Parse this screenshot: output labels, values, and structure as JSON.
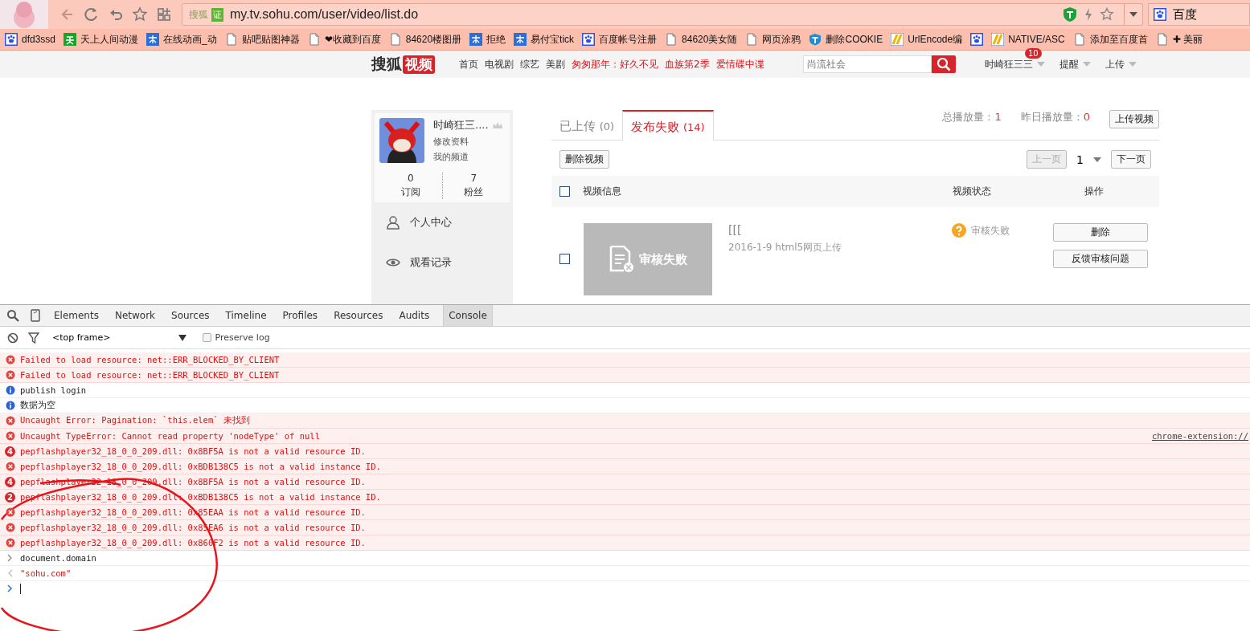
{
  "browser": {
    "address": {
      "site_label": "搜狐",
      "badge": "证",
      "url": "my.tv.sohu.com/user/video/list.do"
    },
    "search_engine": "百度",
    "bookmarks": [
      {
        "kind": "paw",
        "label": "dfd3ssd"
      },
      {
        "kind": "green",
        "label": "天上人间动漫"
      },
      {
        "kind": "blue",
        "label": "在线动画_动"
      },
      {
        "kind": "page",
        "label": "贴吧贴图神器"
      },
      {
        "kind": "page",
        "label": "❤收藏到百度"
      },
      {
        "kind": "page",
        "label": "84620楼图册"
      },
      {
        "kind": "blue",
        "label": "拒绝"
      },
      {
        "kind": "blue",
        "label": "易付宝tick"
      },
      {
        "kind": "paw",
        "label": "百度帐号注册"
      },
      {
        "kind": "page",
        "label": "84620美女随"
      },
      {
        "kind": "page",
        "label": "网页涂鸦"
      },
      {
        "kind": "shield",
        "label": "删除COOKIE"
      },
      {
        "kind": "stripe",
        "label": "UrlEncode编"
      },
      {
        "kind": "paw"
      },
      {
        "kind": "stripe",
        "label": "NATIVE/ASC"
      },
      {
        "kind": "page",
        "label": "添加至百度首"
      },
      {
        "kind": "page",
        "label": "✚ 美丽"
      }
    ]
  },
  "site": {
    "logo": {
      "left": "搜狐",
      "right": "视频"
    },
    "nav": [
      {
        "label": "首页",
        "hot": false
      },
      {
        "label": "电视剧",
        "hot": false
      },
      {
        "label": "综艺",
        "hot": false
      },
      {
        "label": "美剧",
        "hot": false
      },
      {
        "label": "匆匆那年：好久不见",
        "hot": true
      },
      {
        "label": "血族第2季",
        "hot": true
      },
      {
        "label": "爱情碟中谍",
        "hot": true
      }
    ],
    "search": {
      "placeholder": "尚流社会"
    },
    "user": {
      "name": "时崎狂三三",
      "badge": "10"
    },
    "menus": [
      "提醒",
      "上传"
    ]
  },
  "sidebar": {
    "name": "时崎狂三....",
    "links": [
      "修改资料",
      "我的频道"
    ],
    "stats": [
      {
        "value": "0",
        "label": "订阅"
      },
      {
        "value": "7",
        "label": "粉丝"
      }
    ],
    "items": [
      {
        "kind": "person",
        "label": "个人中心"
      },
      {
        "kind": "eye",
        "label": "观看记录"
      }
    ]
  },
  "content": {
    "tabs": [
      {
        "label": "已上传",
        "count": "(0)",
        "selected": false
      },
      {
        "label": "发布失败",
        "count": "(14)",
        "selected": true
      }
    ],
    "stats": [
      {
        "label": "总播放量：",
        "value": "1"
      },
      {
        "label": "昨日播放量：",
        "value": "0"
      }
    ],
    "upload_button": "上传视频",
    "delete_button": "删除视频",
    "pagination": {
      "prev": "上一页",
      "prev_disabled": true,
      "page": "1",
      "next": "下一页"
    },
    "table": {
      "columns": [
        "视频信息",
        "视频状态",
        "操作"
      ],
      "header_checked": false,
      "rows": [
        {
          "checked": false,
          "thumbnail_text": "审核失败",
          "title": "[[[",
          "meta": "2016-1-9 html5网页上传",
          "status": "审核失败",
          "actions": [
            "删除",
            "反馈审核问题"
          ]
        }
      ]
    }
  },
  "devtools": {
    "tabs": [
      {
        "label": "Elements",
        "selected": false
      },
      {
        "label": "Network",
        "selected": false
      },
      {
        "label": "Sources",
        "selected": false
      },
      {
        "label": "Timeline",
        "selected": false
      },
      {
        "label": "Profiles",
        "selected": false
      },
      {
        "label": "Resources",
        "selected": false
      },
      {
        "label": "Audits",
        "selected": false
      },
      {
        "label": "Console",
        "selected": true
      }
    ],
    "frame": "<top frame>",
    "preserve_log": {
      "label": "Preserve log",
      "checked": false
    },
    "messages": [
      {
        "kind": "error",
        "text": "Failed to load resource: net::ERR_BLOCKED_BY_CLIENT"
      },
      {
        "kind": "error",
        "text": "Failed to load resource: net::ERR_BLOCKED_BY_CLIENT"
      },
      {
        "kind": "info",
        "text": "publish login"
      },
      {
        "kind": "info",
        "text": "数据为空"
      },
      {
        "kind": "error",
        "text": "Uncaught Error: Pagination: `this.elem` 未找到"
      },
      {
        "kind": "error",
        "text": "Uncaught TypeError: Cannot read property 'nodeType' of null",
        "source": "chrome-extension://"
      },
      {
        "kind": "error",
        "count": "4",
        "text": "pepflashplayer32_18_0_0_209.dll: 0x8BF5A is not a valid resource ID."
      },
      {
        "kind": "error",
        "text": "pepflashplayer32_18_0_0_209.dll: 0xBDB138C5 is not a valid instance ID."
      },
      {
        "kind": "error",
        "count": "4",
        "text": "pepflashplayer32_18_0_0_209.dll: 0x8BF5A is not a valid resource ID."
      },
      {
        "kind": "error",
        "count": "2",
        "text": "pepflashplayer32_18_0_0_209.dll: 0xBDB138C5 is not a valid instance ID."
      },
      {
        "kind": "error",
        "text": "pepflashplayer32_18_0_0_209.dll: 0x85EAA is not a valid resource ID."
      },
      {
        "kind": "error",
        "text": "pepflashplayer32_18_0_0_209.dll: 0x85EA6 is not a valid resource ID."
      },
      {
        "kind": "error",
        "text": "pepflashplayer32_18_0_0_209.dll: 0x860F2 is not a valid resource ID."
      },
      {
        "kind": "input",
        "text": "document.domain"
      },
      {
        "kind": "output",
        "text": "\"sohu.com\""
      },
      {
        "kind": "prompt"
      }
    ]
  }
}
